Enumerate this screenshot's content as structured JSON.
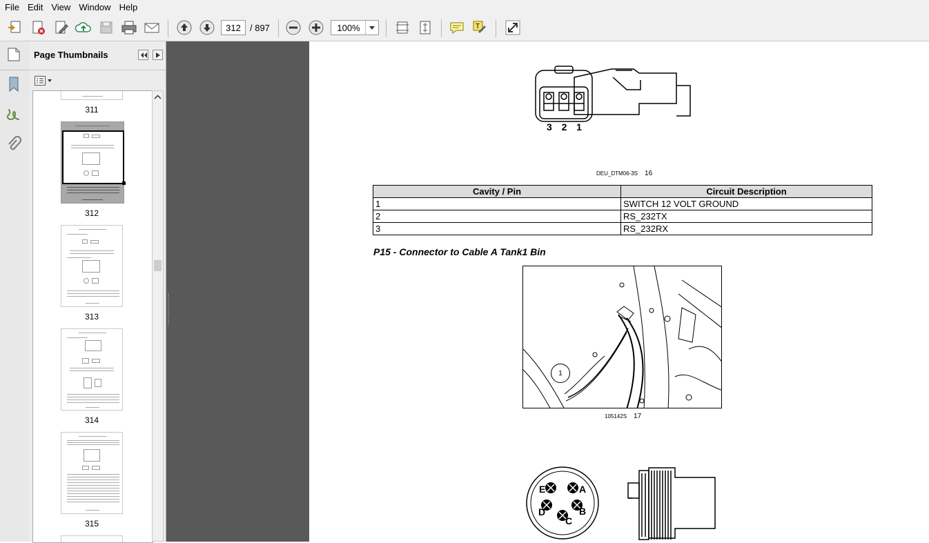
{
  "menu": [
    "File",
    "Edit",
    "View",
    "Window",
    "Help"
  ],
  "toolbar": {
    "current_page": "312",
    "total_pages": "/ 897",
    "zoom": "100%"
  },
  "panel": {
    "title": "Page Thumbnails"
  },
  "thumbnails": [
    {
      "label": "311"
    },
    {
      "label": "312",
      "selected": true
    },
    {
      "label": "313"
    },
    {
      "label": "314"
    },
    {
      "label": "315"
    }
  ],
  "document": {
    "connector1_pins": "3  2  1",
    "figure16_code": "DEU_DTM06-3S",
    "figure16_num": "16",
    "table": {
      "headers": [
        "Cavity / Pin",
        "Circuit Description"
      ],
      "rows": [
        [
          "1",
          "SWITCH 12 VOLT GROUND"
        ],
        [
          "2",
          "RS_232TX"
        ],
        [
          "3",
          "RS_232RX"
        ]
      ]
    },
    "section_title": "P15 - Connector to Cable A Tank1 Bin",
    "photo_callout": "1",
    "figure17_code": "105142S",
    "figure17_num": "17",
    "connector2_letters": [
      "A",
      "B",
      "C",
      "D",
      "E"
    ]
  },
  "colors": {
    "toolbar_bg": "#f0f0f0",
    "gutter_bg": "#595959",
    "header_fill": "#dcdcdc"
  }
}
